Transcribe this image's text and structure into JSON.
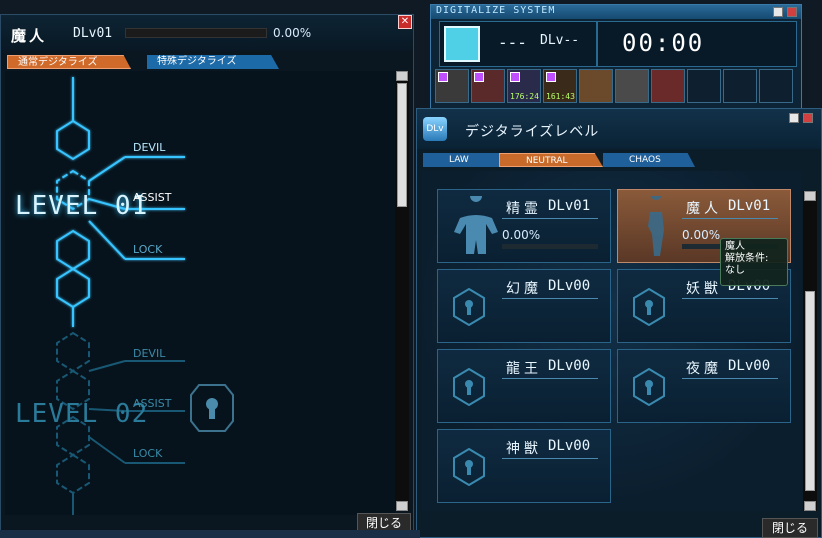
{
  "left_window": {
    "name": "魔人",
    "level": "DLv01",
    "percent": "0.00%",
    "tabs": [
      "通常デジタライズ",
      "特殊デジタライズ"
    ],
    "tree": [
      {
        "level": "LEVEL 01",
        "branches": [
          "DEVIL",
          "ASSIST",
          "LOCK"
        ]
      },
      {
        "level": "LEVEL 02",
        "branches": [
          "DEVIL",
          "ASSIST",
          "LOCK"
        ]
      }
    ],
    "close_label": "閉じる"
  },
  "digitalize_system": {
    "title": "DIGITALIZE SYSTEM",
    "dash": "---",
    "level": "DLv--",
    "time": "00:00",
    "demon_icons": [
      {
        "name": "demon-icon-1",
        "stat": ""
      },
      {
        "name": "demon-icon-2",
        "stat": ""
      },
      {
        "name": "demon-icon-3",
        "stat": "176:24"
      },
      {
        "name": "demon-icon-4",
        "stat": "161:43"
      },
      {
        "name": "demon-icon-5",
        "stat": ""
      },
      {
        "name": "demon-icon-6",
        "stat": ""
      },
      {
        "name": "demon-icon-7",
        "stat": ""
      }
    ]
  },
  "digitalize_level": {
    "logo": "DLv",
    "title": "デジタライズレベル",
    "tabs": [
      "LAW",
      "NEUTRAL",
      "CHAOS"
    ],
    "cards": [
      {
        "name": "精霊",
        "level": "DLv01",
        "percent": "0.00%",
        "progress": 0.0,
        "locked": false
      },
      {
        "name": "魔人",
        "level": "DLv01",
        "percent": "0.00%",
        "progress": 0.0,
        "locked": false,
        "selected": true
      },
      {
        "name": "幻魔",
        "level": "DLv00",
        "locked": true
      },
      {
        "name": "妖獣",
        "level": "DLv00",
        "locked": true
      },
      {
        "name": "龍王",
        "level": "DLv00",
        "locked": true
      },
      {
        "name": "夜魔",
        "level": "DLv00",
        "locked": true
      },
      {
        "name": "神獣",
        "level": "DLv00",
        "locked": true
      }
    ],
    "tooltip": {
      "line1": "魔人",
      "line2": "解放条件:",
      "line3": "なし"
    },
    "close_label": "閉じる"
  },
  "colors": {
    "accent_orange": "#c86a2a",
    "accent_blue": "#1f5f9a",
    "cyan": "#4fd0e6"
  }
}
